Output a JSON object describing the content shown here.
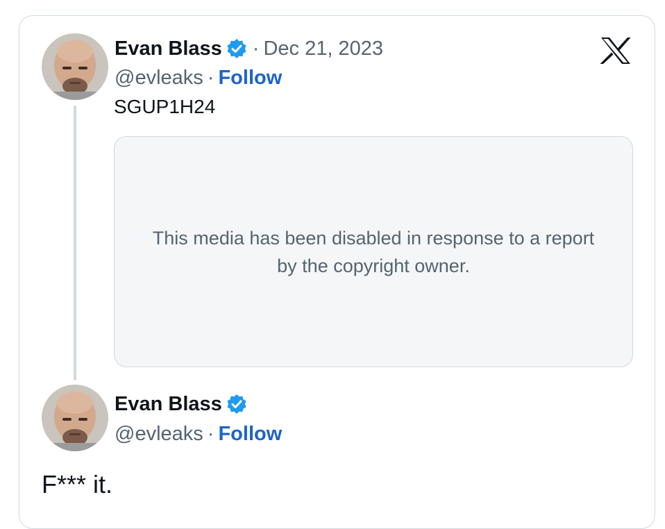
{
  "tweet_main": {
    "author_name": "Evan Blass",
    "separator": "·",
    "date": "Dec 21, 2023",
    "handle": "@evleaks",
    "follow_label": "Follow",
    "text": "SGUP1H24",
    "media_message": "This media has been disabled in response to a report by the copyright owner."
  },
  "tweet_reply": {
    "author_name": "Evan Blass",
    "separator": "·",
    "handle": "@evleaks",
    "follow_label": "Follow",
    "text": "F*** it."
  },
  "icons": {
    "verified": "verified-badge-icon",
    "brand": "x-logo-icon",
    "avatar": "avatar"
  },
  "colors": {
    "follow": "#1d64c8",
    "verified": "#1d9bf0",
    "muted_text": "#536471",
    "border": "#cfd9de"
  }
}
